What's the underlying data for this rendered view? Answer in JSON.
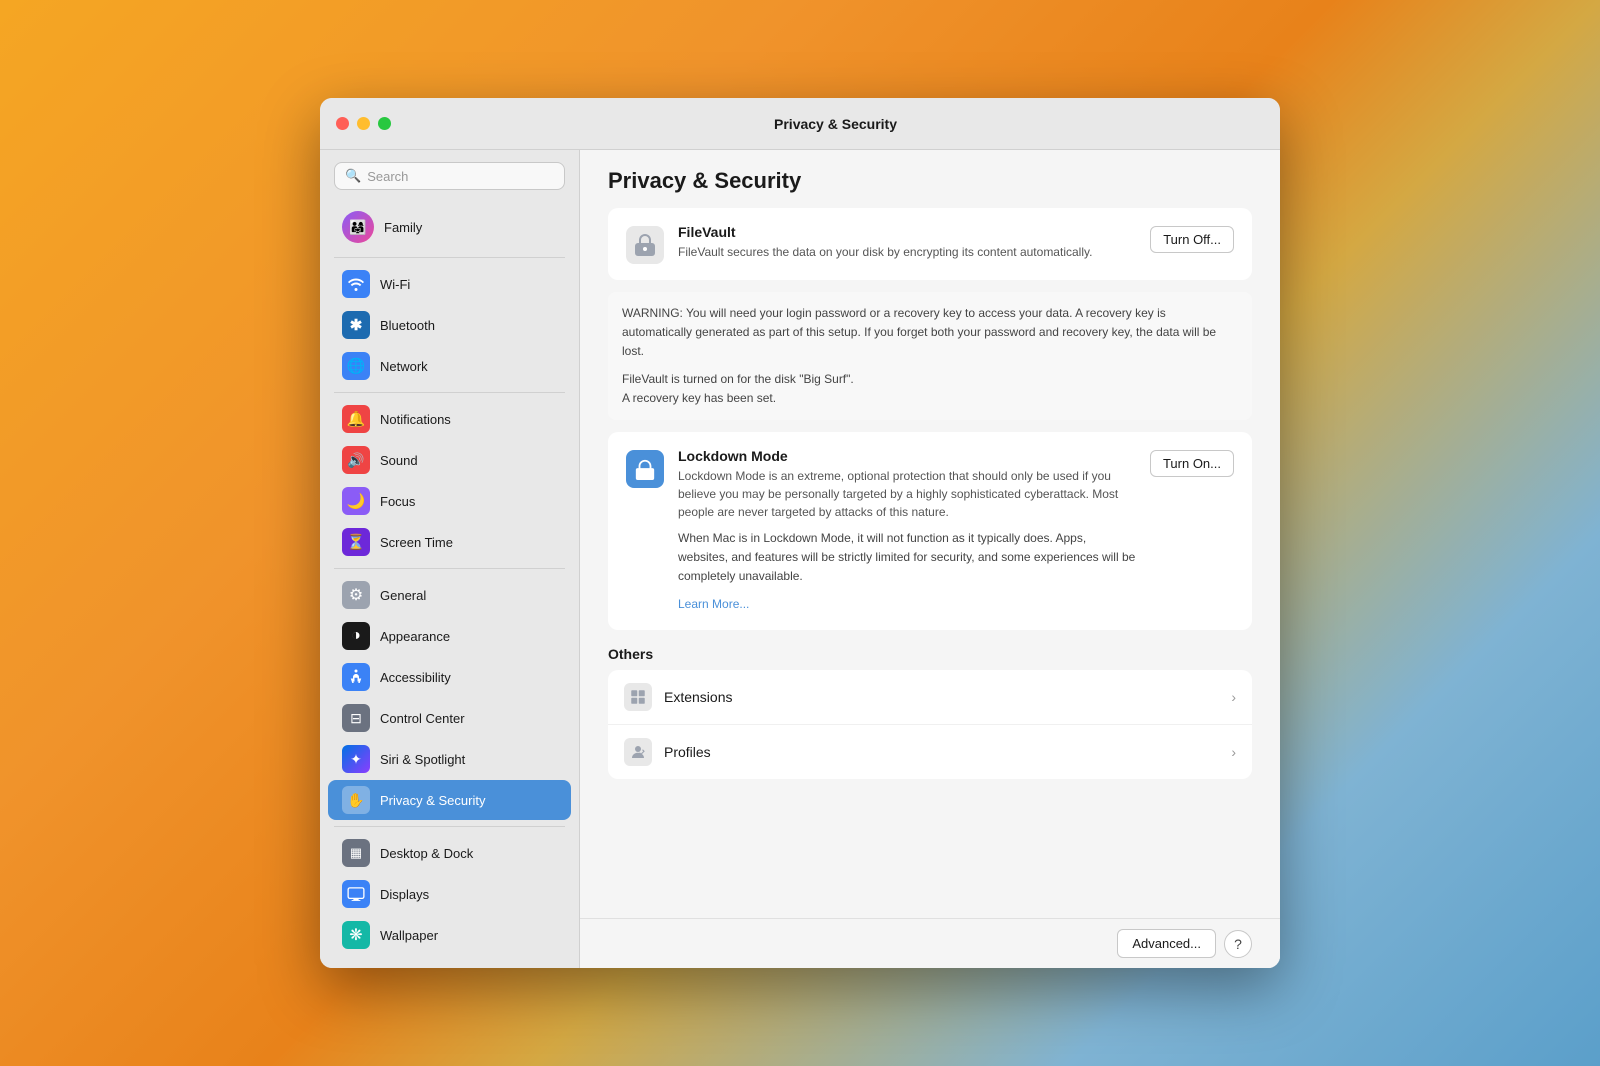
{
  "window": {
    "title": "Privacy & Security"
  },
  "sidebar": {
    "search_placeholder": "Search",
    "profile": {
      "name": "Family",
      "avatar_emoji": "👨‍👩‍👧"
    },
    "items": [
      {
        "id": "wifi",
        "label": "Wi-Fi",
        "icon": "📶",
        "bg": "bg-blue",
        "icon_char": "wifi"
      },
      {
        "id": "bluetooth",
        "label": "Bluetooth",
        "icon": "✱",
        "bg": "bg-blue-dark",
        "icon_char": "bluetooth"
      },
      {
        "id": "network",
        "label": "Network",
        "icon": "🌐",
        "bg": "bg-blue",
        "icon_char": "network"
      },
      {
        "id": "notifications",
        "label": "Notifications",
        "icon": "🔔",
        "bg": "bg-red",
        "icon_char": "bell"
      },
      {
        "id": "sound",
        "label": "Sound",
        "icon": "🔊",
        "bg": "bg-red",
        "icon_char": "speaker"
      },
      {
        "id": "focus",
        "label": "Focus",
        "icon": "🌙",
        "bg": "bg-purple",
        "icon_char": "moon"
      },
      {
        "id": "screen-time",
        "label": "Screen Time",
        "icon": "⏳",
        "bg": "bg-purple-dark",
        "icon_char": "hourglass"
      },
      {
        "id": "general",
        "label": "General",
        "icon": "⚙",
        "bg": "bg-gray",
        "icon_char": "gear"
      },
      {
        "id": "appearance",
        "label": "Appearance",
        "icon": "◑",
        "bg": "bg-black",
        "icon_char": "circle"
      },
      {
        "id": "accessibility",
        "label": "Accessibility",
        "icon": "♿",
        "bg": "bg-blue",
        "icon_char": "accessibility"
      },
      {
        "id": "control-center",
        "label": "Control Center",
        "icon": "⊟",
        "bg": "bg-gray-dark",
        "icon_char": "control"
      },
      {
        "id": "siri",
        "label": "Siri & Spotlight",
        "icon": "✦",
        "bg": "bg-gradient-siri",
        "icon_char": "siri"
      },
      {
        "id": "privacy-security",
        "label": "Privacy & Security",
        "icon": "✋",
        "bg": "bg-blue",
        "icon_char": "hand",
        "active": true
      },
      {
        "id": "desktop-dock",
        "label": "Desktop & Dock",
        "icon": "▦",
        "bg": "bg-gray-dark",
        "icon_char": "dock"
      },
      {
        "id": "displays",
        "label": "Displays",
        "icon": "✳",
        "bg": "bg-blue",
        "icon_char": "display"
      },
      {
        "id": "wallpaper",
        "label": "Wallpaper",
        "icon": "❋",
        "bg": "bg-teal",
        "icon_char": "wallpaper"
      }
    ]
  },
  "detail": {
    "title": "Privacy & Security",
    "filevault": {
      "title": "FileVault",
      "description": "FileVault secures the data on your disk by encrypting its content automatically.",
      "button_label": "Turn Off...",
      "warning": "WARNING: You will need your login password or a recovery key to access your data. A recovery key is automatically generated as part of this setup. If you forget both your password and recovery key, the data will be lost.",
      "status_line1": "FileVault is turned on for the disk \"Big Surf\".",
      "status_line2": "A recovery key has been set."
    },
    "lockdown": {
      "title": "Lockdown Mode",
      "description1": "Lockdown Mode is an extreme, optional protection that should only be used if you believe you may be personally targeted by a highly sophisticated cyberattack. Most people are never targeted by attacks of this nature.",
      "description2": "When Mac is in Lockdown Mode, it will not function as it typically does. Apps, websites, and features will be strictly limited for security, and some experiences will be completely unavailable.",
      "learn_more": "Learn More...",
      "button_label": "Turn On..."
    },
    "others_header": "Others",
    "list_items": [
      {
        "id": "extensions",
        "label": "Extensions"
      },
      {
        "id": "profiles",
        "label": "Profiles"
      }
    ],
    "bottom": {
      "advanced_button": "Advanced...",
      "help_button": "?"
    }
  }
}
